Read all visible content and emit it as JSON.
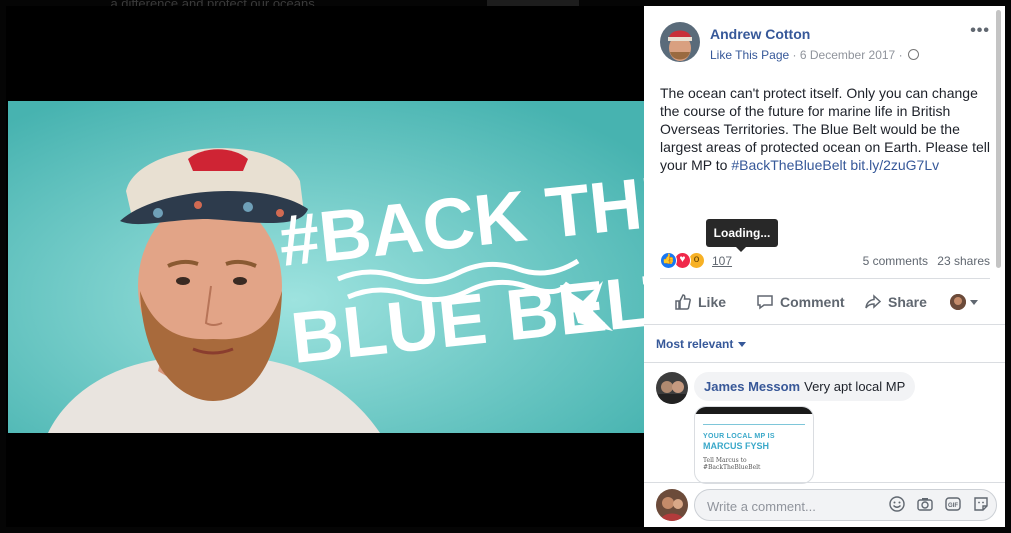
{
  "background": {
    "partial_text": "... a difference and protect our oceans"
  },
  "photo": {
    "hashtag_line1": "#BACK THE",
    "hashtag_line2": "BLUE BELT",
    "bg_color": "#5fc5c2"
  },
  "post": {
    "author": "Andrew Cotton",
    "like_page": "Like This Page",
    "separator": " · ",
    "date": "6 December 2017",
    "more_icon": "more-options-icon",
    "text_main": "The ocean can't protect itself. Only you can change the course of the future for marine life in British Overseas Territories. The Blue Belt would be the largest areas of protected ocean on Earth. Please tell your MP to ",
    "text_hashtag": "#BackTheBlueBelt",
    "text_link": "bit.ly/2zuG7Lv",
    "tooltip": "Loading...",
    "reaction_count": "107",
    "comments_count": "5 comments",
    "shares_count": "23 shares"
  },
  "actions": {
    "like": "Like",
    "comment": "Comment",
    "share": "Share"
  },
  "comments": {
    "filter": "Most relevant",
    "items": [
      {
        "author": "James Messom",
        "text": "Very apt local MP"
      }
    ],
    "attachment": {
      "line1": "YOUR LOCAL MP IS",
      "line2": "MARCUS FYSH",
      "line3": "Tell Marcus to #BackTheBlueBelt"
    },
    "composer_placeholder": "Write a comment..."
  },
  "colors": {
    "link": "#365899",
    "muted": "#606770",
    "like_blue": "#1877f2",
    "love_red": "#f0284a",
    "wow_yellow": "#f7b125"
  }
}
